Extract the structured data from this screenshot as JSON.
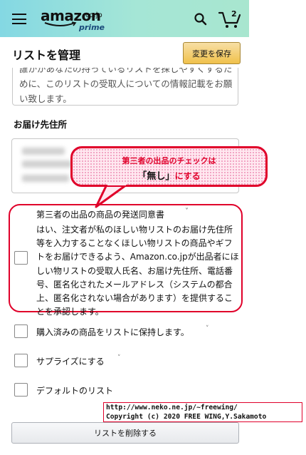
{
  "header": {
    "logo_text": "amazon",
    "logo_domain": "co.jp",
    "logo_sub": "prime",
    "cart_count": "2",
    "icons": [
      "menu-icon",
      "search-icon",
      "cart-icon"
    ]
  },
  "page": {
    "title": "リストを管理",
    "save_label": "変更を保存"
  },
  "description": {
    "text": "誰かがあなたの持っているリストを探しやすくするために、このリストの受取人についての情報記載をお願い致します。"
  },
  "address": {
    "label": "お届け先住所"
  },
  "callout": {
    "line1": "第三者の出品のチェックは",
    "line2_emph": "「無し」",
    "line2_rest": "にする"
  },
  "consent": {
    "title": "第三者の出品の商品の発送同意書",
    "chevron": "˅",
    "body": "はい、注文者が私のほしい物リストのお届け先住所等を入力することなくほしい物リストの商品やギフトをお届けできるよう、Amazon.co.jpが出品者にほしい物リストの受取人氏名、お届け先住所、電話番号、匿名化されたメールアドレス（システムの都合上、匿名化されない場合があります）を提供することを承認します。"
  },
  "options": [
    {
      "label": "購入済みの商品をリストに保持します。",
      "chevron": "˅"
    },
    {
      "label": "サプライズにする",
      "chevron": "˅"
    },
    {
      "label": "デフォルトのリスト",
      "chevron": ""
    }
  ],
  "watermark": {
    "line1": "http://www.neko.ne.jp/~freewing/",
    "line2": "Copyright (c) 2020 FREE WING,Y.Sakamoto"
  },
  "footer": {
    "delete_label": "リストを削除する"
  },
  "colors": {
    "header_gradient_start": "#84d8e3",
    "header_gradient_end": "#a8e6cf",
    "save_button": "#f0c14b",
    "annotation_red": "#e0002a"
  }
}
